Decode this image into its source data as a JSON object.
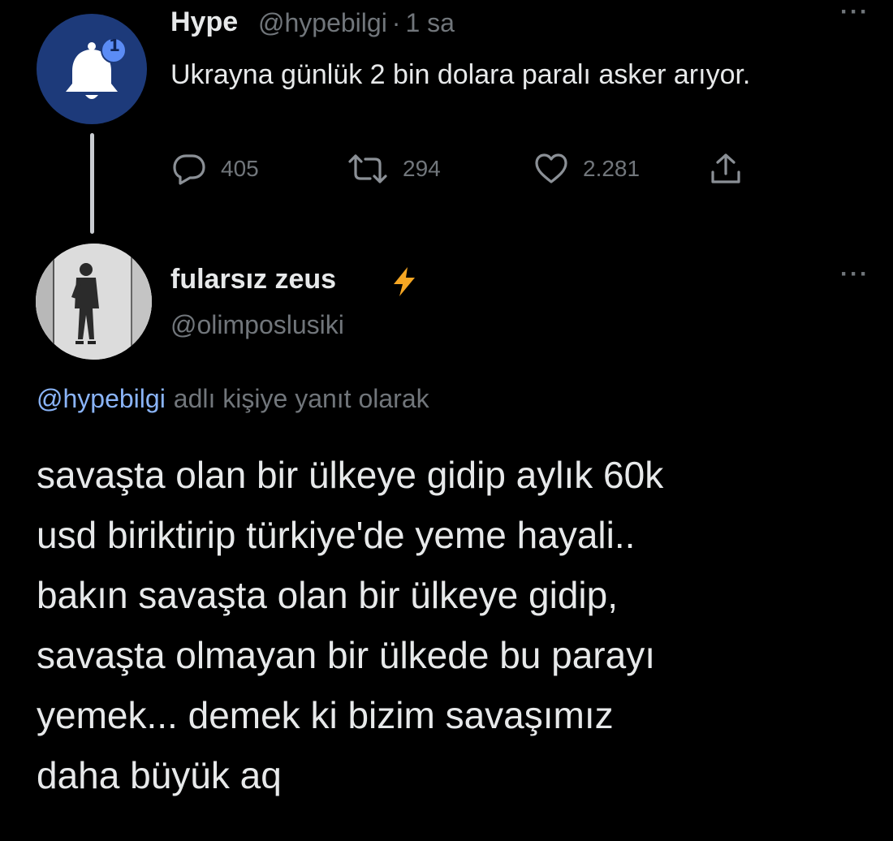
{
  "original_tweet": {
    "author_name": "Hype",
    "author_handle": "@hypebilgi",
    "separator": "·",
    "time": "1 sa",
    "notification_count": "1",
    "text": "Ukrayna günlük 2 bin dolara paralı asker arıyor.",
    "more_label": "···",
    "actions": {
      "replies": "405",
      "retweets": "294",
      "likes": "2.281"
    }
  },
  "reply_tweet": {
    "author_name": "fularsız zeus",
    "author_handle": "@olimposlusiki",
    "more_label": "···",
    "reply_context": {
      "mention": "@hypebilgi",
      "suffix": "adlı kişiye yanıt olarak"
    },
    "text_lines": [
      "savaşta olan bir ülkeye gidip aylık 60k",
      "usd biriktirip türkiye'de yeme hayali..",
      "bakın savaşta olan bir ülkeye gidip,",
      "savaşta olmayan bir ülkede bu parayı",
      "yemek... demek ki bizim savaşımız",
      "daha büyük aq"
    ]
  },
  "colors": {
    "background": "#000000",
    "text_primary": "#e7e9ea",
    "text_secondary": "#71767b",
    "mention": "#8ab4f8",
    "hype_avatar_bg": "#1d3a7a",
    "bolt": "#f5a623"
  },
  "icons": {
    "notification": "bell-icon",
    "reply": "reply-icon",
    "retweet": "retweet-icon",
    "like": "heart-icon",
    "share": "share-icon",
    "verified_emoji": "lightning-bolt-icon"
  }
}
